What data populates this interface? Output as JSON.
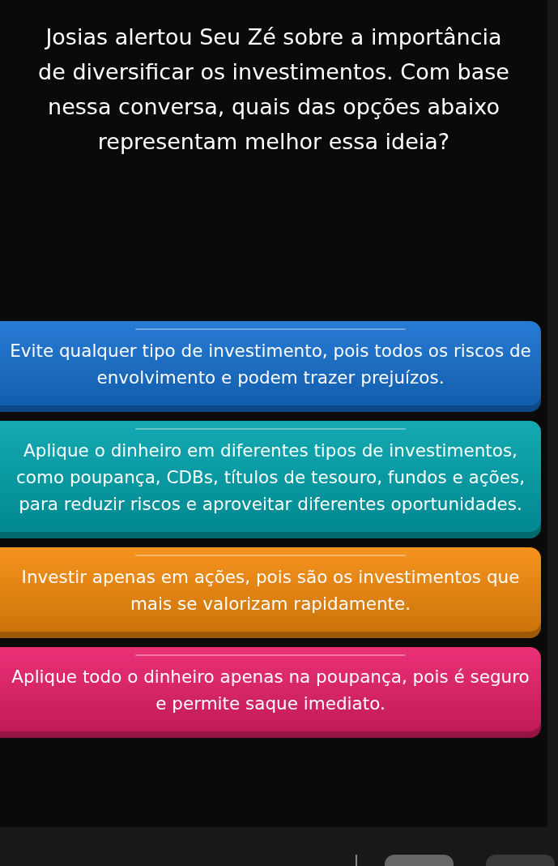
{
  "question": "Josias alertou Seu Zé sobre a importância de diversificar os investimentos. Com base nessa conversa, quais das opções abaixo representam melhor essa ideia?",
  "options": [
    {
      "text": "Evite qualquer tipo de investimento, pois todos os riscos de envolvimento e podem trazer prejuízos.",
      "color": "#1570d0"
    },
    {
      "text": "Aplique o dinheiro em diferentes tipos de investimentos, como poupança, CDBs, títulos de tesouro, fundos e ações, para reduzir riscos e aproveitar diferentes oportunidades.",
      "color": "#00a3ad"
    },
    {
      "text": "Investir apenas em ações, pois são os investimentos que mais se valorizam rapidamente.",
      "color": "#f58a0a"
    },
    {
      "text": "Aplique todo o dinheiro apenas na poupança, pois é seguro e permite saque imediato.",
      "color": "#e81f6a"
    }
  ]
}
